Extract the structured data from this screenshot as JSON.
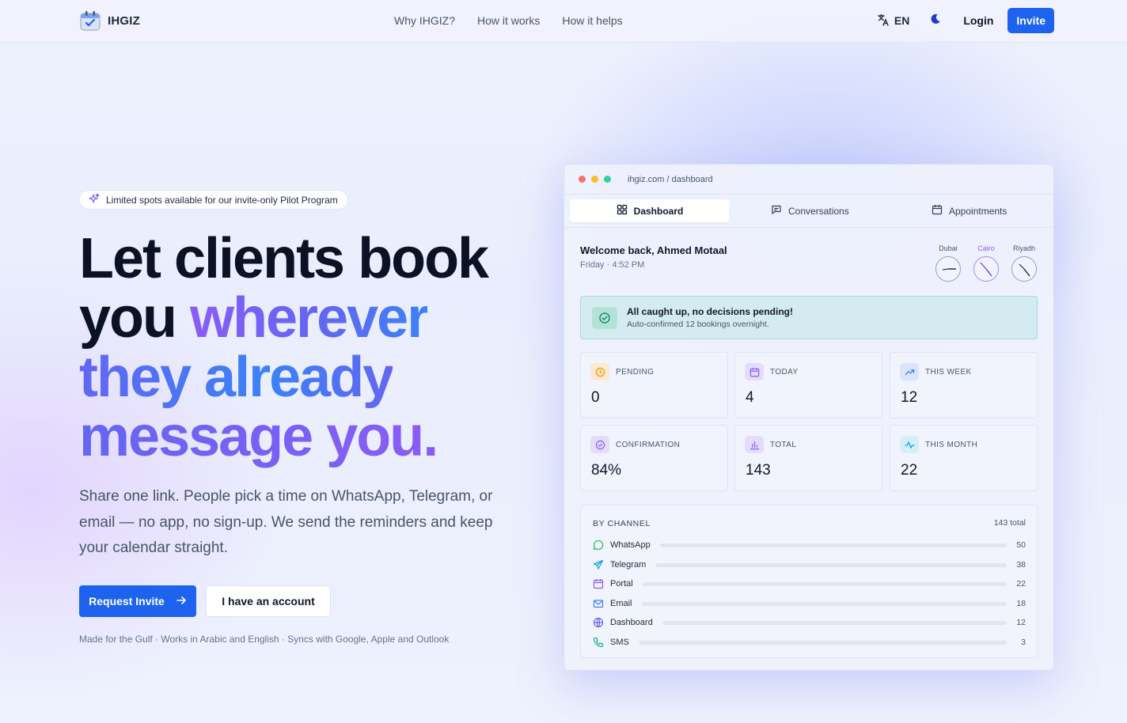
{
  "nav": {
    "brand": "IHGIZ",
    "links": [
      "Why IHGIZ?",
      "How it works",
      "How it helps"
    ],
    "lang": "EN",
    "login": "Login",
    "invite": "Invite"
  },
  "hero": {
    "pill": "Limited spots available for our invite-only Pilot Program",
    "headline_1": "Let clients book",
    "headline_2": "you ",
    "headline_3": "wherever",
    "headline_4": "they already",
    "headline_5": "message you.",
    "sub": "Share one link. People pick a time on WhatsApp, Telegram, or email — no app, no sign-up. We send the reminders and keep your calendar straight.",
    "primary_cta": "Request Invite",
    "secondary_cta": "I have an account",
    "footnote": "Made for the Gulf · Works in Arabic and English · Syncs with Google, Apple and Outlook"
  },
  "dashboard": {
    "url": "ihgiz.com / dashboard",
    "tabs": [
      "Dashboard",
      "Conversations",
      "Appointments"
    ],
    "welcome": "Welcome back, Ahmed Motaal",
    "date": "Friday · 4:52 PM",
    "clocks": [
      "Dubai",
      "Cairo",
      "Riyadh"
    ],
    "alert_title": "All caught up, no decisions pending!",
    "alert_sub": "Auto-confirmed 12 bookings overnight.",
    "stats": [
      {
        "label": "PENDING",
        "value": "0"
      },
      {
        "label": "TODAY",
        "value": "4"
      },
      {
        "label": "THIS WEEK",
        "value": "12"
      },
      {
        "label": "CONFIRMATION",
        "value": "84%"
      },
      {
        "label": "TOTAL",
        "value": "143"
      },
      {
        "label": "THIS MONTH",
        "value": "22"
      }
    ],
    "by_channel_title": "BY CHANNEL",
    "by_channel_total": "143 total",
    "channels": [
      {
        "name": "WhatsApp",
        "value": "50"
      },
      {
        "name": "Telegram",
        "value": "38"
      },
      {
        "name": "Portal",
        "value": "22"
      },
      {
        "name": "Email",
        "value": "18"
      },
      {
        "name": "Dashboard",
        "value": "12"
      },
      {
        "name": "SMS",
        "value": "3"
      }
    ]
  },
  "colors": {
    "primary": "#1d63ed",
    "gradient_start": "#8b5cf6",
    "gradient_end": "#3b82f6",
    "whatsapp": "#22c55e",
    "telegram": "#0ea5e9"
  }
}
